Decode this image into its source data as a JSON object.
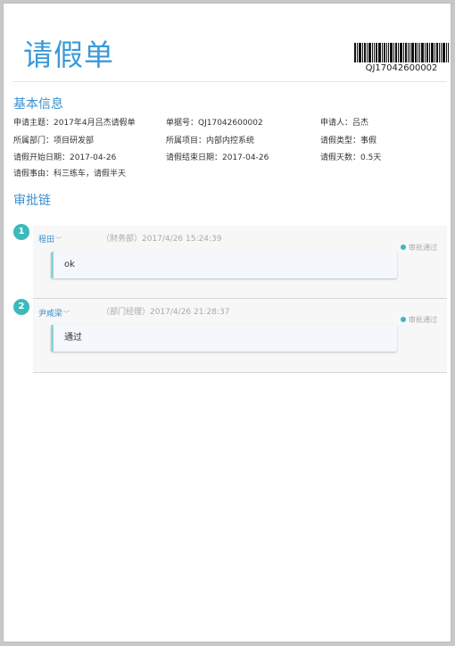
{
  "document": {
    "title": "请假单",
    "barcode_text": "QJ17042600002"
  },
  "basic_info": {
    "heading": "基本信息",
    "fields": [
      {
        "text": "申请主题：2017年4月吕杰请假单"
      },
      {
        "text": "单据号：QJ17042600002"
      },
      {
        "text": "申请人：吕杰"
      },
      {
        "text": "所属部门：项目研发部"
      },
      {
        "text": "所属项目：内部内控系统"
      },
      {
        "text": "请假类型：事假"
      },
      {
        "text": "请假开始日期：2017-04-26"
      },
      {
        "text": "请假结束日期：2017-04-26"
      },
      {
        "text": "请假天数：0.5天"
      },
      {
        "text": "请假事由：科三练车，请假半天"
      }
    ]
  },
  "approval_chain": {
    "heading": "审批链",
    "steps": [
      {
        "number": "1",
        "approver": "程田",
        "role_time": "（财务部）2017/4/26 15:24:39",
        "status": "审批通过",
        "comment": "ok"
      },
      {
        "number": "2",
        "approver": "尹咸梁",
        "role_time": "（部门经理）2017/4/26 21:28:37",
        "status": "审批通过",
        "comment": "通过"
      }
    ]
  },
  "colors": {
    "accent": "#3a9ad9",
    "step_badge": "#3cb9b9",
    "comment_border": "#8fd3dc"
  },
  "icons": {
    "chevron": "chevron-down-icon",
    "status_dot": "status-dot-icon"
  }
}
